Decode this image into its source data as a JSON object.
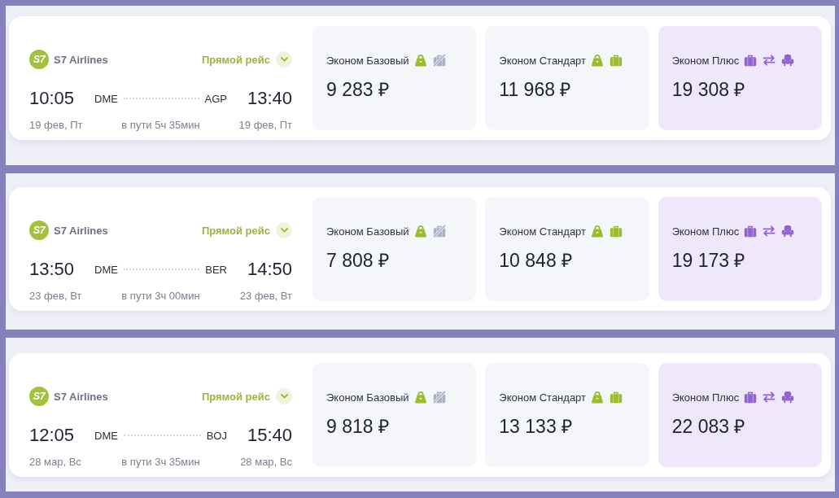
{
  "flights": [
    {
      "airline": {
        "logo": "S7",
        "name": "S7 Airlines"
      },
      "route_type": "Прямой рейс",
      "expanded": false,
      "departure": {
        "time": "10:05",
        "airport": "DME",
        "date": "19 фев, Пт"
      },
      "arrival": {
        "time": "13:40",
        "airport": "AGP",
        "date": "19 фев, Пт"
      },
      "duration": "в пути 5ч 35мин",
      "fares": [
        {
          "name": "Эконом Базовый",
          "price": "9 283 ₽",
          "highlighted": false,
          "features": [
            {
              "kind": "hand_luggage",
              "included": true
            },
            {
              "kind": "baggage",
              "included": false
            }
          ]
        },
        {
          "name": "Эконом Стандарт",
          "price": "11 968 ₽",
          "highlighted": false,
          "features": [
            {
              "kind": "hand_luggage",
              "included": true
            },
            {
              "kind": "baggage",
              "included": true
            }
          ]
        },
        {
          "name": "Эконом Плюс",
          "price": "19 308 ₽",
          "highlighted": true,
          "features": [
            {
              "kind": "baggage",
              "included": true
            },
            {
              "kind": "exchange",
              "included": true
            },
            {
              "kind": "seat",
              "included": true
            }
          ]
        }
      ]
    },
    {
      "airline": {
        "logo": "S7",
        "name": "S7 Airlines"
      },
      "route_type": "Прямой рейс",
      "expanded": false,
      "departure": {
        "time": "13:50",
        "airport": "DME",
        "date": "23 фев, Вт"
      },
      "arrival": {
        "time": "14:50",
        "airport": "BER",
        "date": "23 фев, Вт"
      },
      "duration": "в пути 3ч 00мин",
      "fares": [
        {
          "name": "Эконом Базовый",
          "price": "7 808 ₽",
          "highlighted": false,
          "features": [
            {
              "kind": "hand_luggage",
              "included": true
            },
            {
              "kind": "baggage",
              "included": false
            }
          ]
        },
        {
          "name": "Эконом Стандарт",
          "price": "10 848 ₽",
          "highlighted": false,
          "features": [
            {
              "kind": "hand_luggage",
              "included": true
            },
            {
              "kind": "baggage",
              "included": true
            }
          ]
        },
        {
          "name": "Эконом Плюс",
          "price": "19 173 ₽",
          "highlighted": true,
          "features": [
            {
              "kind": "baggage",
              "included": true
            },
            {
              "kind": "exchange",
              "included": true
            },
            {
              "kind": "seat",
              "included": true
            }
          ]
        }
      ]
    },
    {
      "airline": {
        "logo": "S7",
        "name": "S7 Airlines"
      },
      "route_type": "Прямой рейс",
      "expanded": false,
      "departure": {
        "time": "12:05",
        "airport": "DME",
        "date": "28 мар, Вс"
      },
      "arrival": {
        "time": "15:40",
        "airport": "BOJ",
        "date": "28 мар, Вс"
      },
      "duration": "в пути 3ч 35мин",
      "fares": [
        {
          "name": "Эконом Базовый",
          "price": "9 818 ₽",
          "highlighted": false,
          "features": [
            {
              "kind": "hand_luggage",
              "included": true
            },
            {
              "kind": "baggage",
              "included": false
            }
          ]
        },
        {
          "name": "Эконом Стандарт",
          "price": "13 133 ₽",
          "highlighted": false,
          "features": [
            {
              "kind": "hand_luggage",
              "included": true
            },
            {
              "kind": "baggage",
              "included": true
            }
          ]
        },
        {
          "name": "Эконом Плюс",
          "price": "22 083 ₽",
          "highlighted": true,
          "features": [
            {
              "kind": "baggage",
              "included": true
            },
            {
              "kind": "exchange",
              "included": true
            },
            {
              "kind": "seat",
              "included": true
            }
          ]
        }
      ]
    }
  ]
}
